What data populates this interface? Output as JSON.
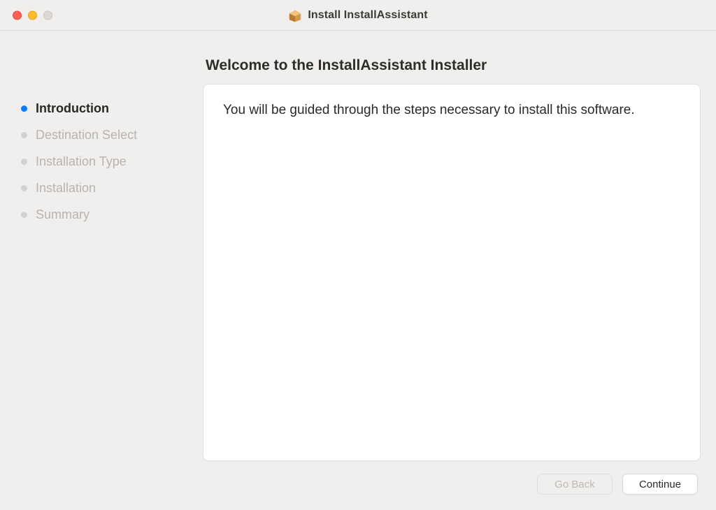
{
  "window": {
    "title": "Install InstallAssistant"
  },
  "sidebar": {
    "steps": [
      {
        "label": "Introduction",
        "active": true
      },
      {
        "label": "Destination Select",
        "active": false
      },
      {
        "label": "Installation Type",
        "active": false
      },
      {
        "label": "Installation",
        "active": false
      },
      {
        "label": "Summary",
        "active": false
      }
    ]
  },
  "content": {
    "heading": "Welcome to the InstallAssistant Installer",
    "body": "You will be guided through the steps necessary to install this software."
  },
  "footer": {
    "back_label": "Go Back",
    "continue_label": "Continue"
  }
}
